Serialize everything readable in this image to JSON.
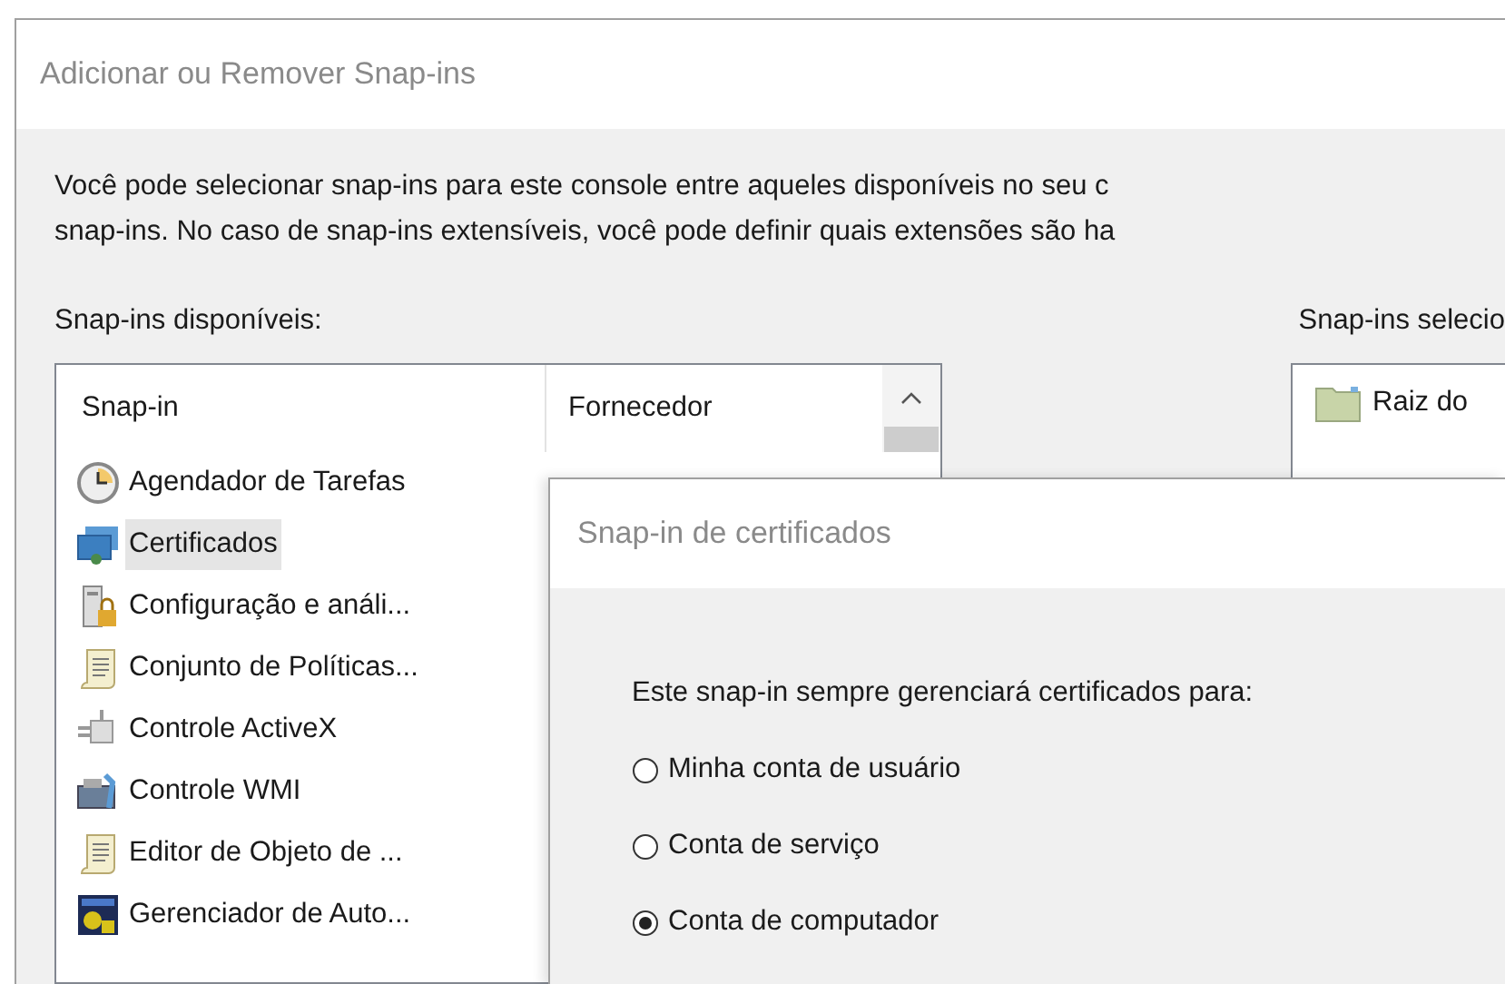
{
  "window": {
    "title": "Adicionar ou Remover Snap-ins"
  },
  "description_lines": [
    "Você pode selecionar snap-ins para este console entre aqueles disponíveis no seu c",
    "snap-ins. No caso de snap-ins extensíveis, você pode definir quais extensões são ha"
  ],
  "available_label": "Snap-ins disponíveis:",
  "selected_label": "Snap-ins selecio",
  "available_list": {
    "columns": [
      "Snap-in",
      "Fornecedor"
    ],
    "items": [
      {
        "name": "Agendador de Tarefas",
        "selected": false
      },
      {
        "name": "Certificados",
        "selected": true
      },
      {
        "name": "Configuração e análi...",
        "selected": false
      },
      {
        "name": "Conjunto de Políticas...",
        "selected": false
      },
      {
        "name": "Controle ActiveX",
        "selected": false
      },
      {
        "name": "Controle WMI",
        "selected": false
      },
      {
        "name": "Editor de Objeto de ...",
        "selected": false
      },
      {
        "name": "Gerenciador de Auto...",
        "selected": false
      }
    ]
  },
  "selected_list": {
    "items": [
      {
        "name": "Raiz do"
      }
    ]
  },
  "dialog": {
    "title": "Snap-in de certificados",
    "prompt": "Este snap-in sempre gerenciará certificados para:",
    "options": [
      {
        "label": "Minha conta de usuário",
        "selected": false
      },
      {
        "label": "Conta de serviço",
        "selected": false
      },
      {
        "label": "Conta de computador",
        "selected": true
      }
    ]
  }
}
